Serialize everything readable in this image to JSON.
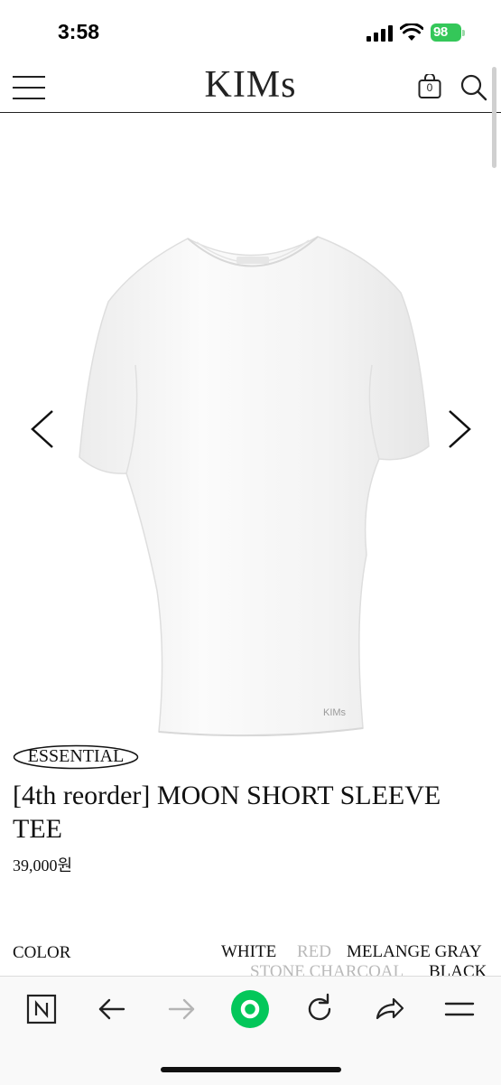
{
  "status_bar": {
    "time": "3:58",
    "battery": "98"
  },
  "header": {
    "logo": "KIMs",
    "cart_count": "0"
  },
  "product": {
    "badge": "ESSENTIAL",
    "title": "[4th reorder] MOON SHORT SLEEVE TEE",
    "price": "39,000원",
    "garment_label": "KIMs"
  },
  "options": {
    "label": "COLOR",
    "colors": [
      {
        "name": "WHITE",
        "status": "available"
      },
      {
        "name": "RED",
        "status": "sold-out"
      },
      {
        "name": "MELANGE GRAY",
        "status": "available"
      },
      {
        "name": "STONE CHARCOAL",
        "status": "sold-out"
      },
      {
        "name": "BLACK",
        "status": "available"
      }
    ]
  },
  "browser_toolbar": {
    "icons": [
      "naver-icon",
      "back-arrow-icon",
      "forward-arrow-icon",
      "home-circle-icon",
      "refresh-icon",
      "share-icon",
      "menu-icon"
    ],
    "accent": "#03c75a"
  }
}
